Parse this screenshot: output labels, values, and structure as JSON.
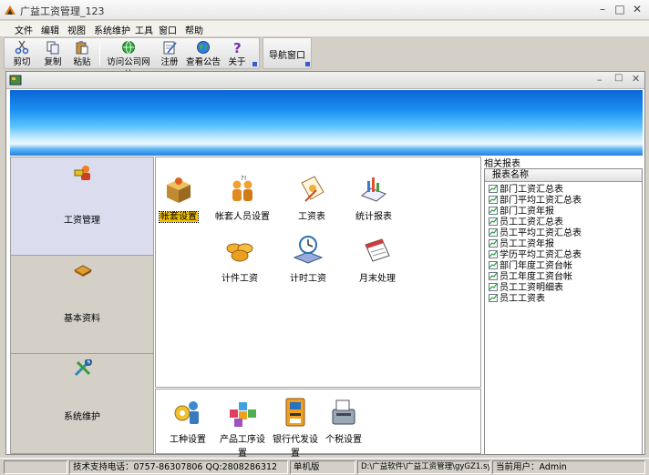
{
  "window": {
    "title": "广益工资管理_123"
  },
  "menu": [
    "文件",
    "编辑",
    "视图",
    "系统维护",
    "工具",
    "窗口",
    "帮助"
  ],
  "toolbar": {
    "buttons": [
      "剪切",
      "复制",
      "粘贴",
      "访问公司网站",
      "注册",
      "查看公告",
      "关于"
    ],
    "nav_label": "导航窗口"
  },
  "left_nav": [
    "工资管理",
    "基本资料",
    "系统维护"
  ],
  "center": {
    "items": [
      "帐套设置",
      "帐套人员设置",
      "工资表",
      "统计报表",
      "计件工资",
      "计时工资",
      "月末处理"
    ],
    "bottom_items": [
      "工种设置",
      "产品工序设置",
      "银行代发设置",
      "个税设置"
    ]
  },
  "reports": {
    "title": "相关报表",
    "column": "报表名称",
    "items": [
      "部门工资汇总表",
      "部门平均工资汇总表",
      "部门工资年报",
      "员工工资汇总表",
      "员工平均工资汇总表",
      "员工工资年报",
      "学历平均工资汇总表",
      "部门年度工资台帐",
      "员工年度工资台帐",
      "员工工资明细表",
      "员工工资表"
    ]
  },
  "status": {
    "support": "技术支持电话：0757-86307806 QQ:2808286312",
    "mode": "单机版",
    "path": "D:\\广益软件\\广益工资管理\\gyGZ1.sys",
    "user": "当前用户：Admin"
  },
  "colors": {
    "banner_top": "#0a66d6",
    "selected_label": "#f5c400",
    "nav_active": "#dcdcef"
  }
}
